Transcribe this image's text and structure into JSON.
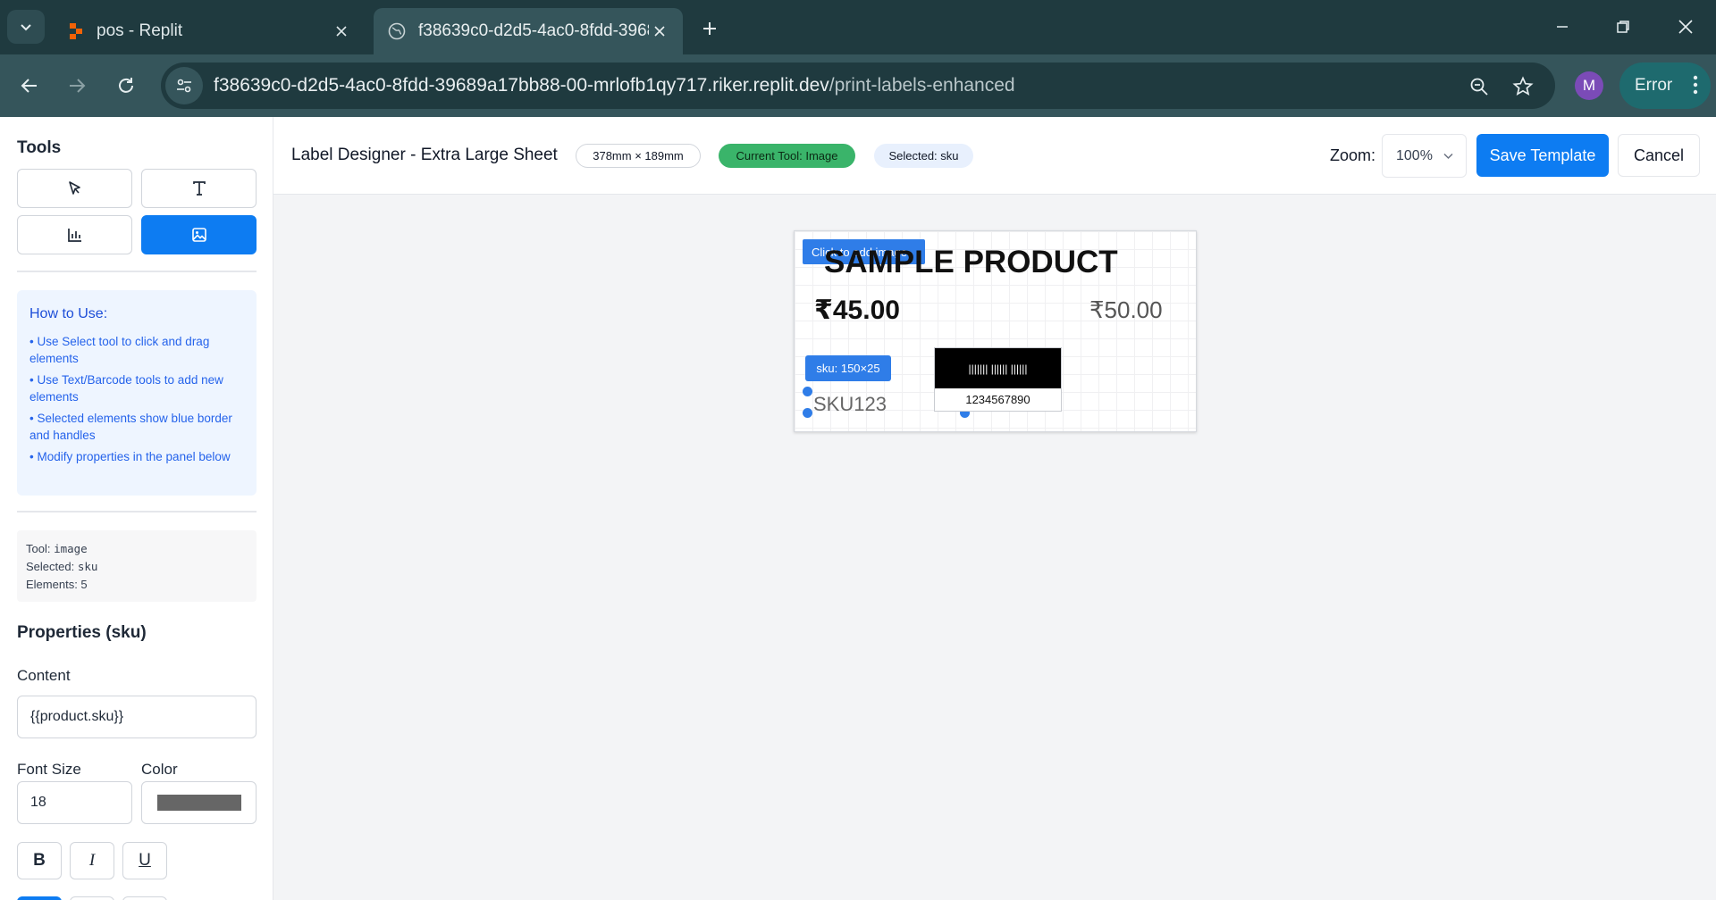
{
  "browser": {
    "tabs": [
      {
        "title": "pos - Replit",
        "active": false,
        "favicon": "replit-logo-icon"
      },
      {
        "title": "f38639c0-d2d5-4ac0-8fdd-3968",
        "active": true,
        "favicon": "globe-icon"
      }
    ],
    "url_host": "f38639c0-d2d5-4ac0-8fdd-39689a17bb88-00-mrlofb1qy717.riker.replit.dev",
    "url_path": "/print-labels-enhanced",
    "profile_initial": "M",
    "error_label": "Error"
  },
  "sidebar": {
    "tools_heading": "Tools",
    "tools": [
      {
        "name": "select",
        "icon": "cursor-arrow-icon",
        "active": false
      },
      {
        "name": "text",
        "icon": "text-t-icon",
        "active": false
      },
      {
        "name": "barcode",
        "icon": "bar-chart-icon",
        "active": false
      },
      {
        "name": "image",
        "icon": "image-icon",
        "active": true
      }
    ],
    "howto": {
      "title": "How to Use:",
      "items": [
        "• Use Select tool to click and drag elements",
        "• Use Text/Barcode tools to add new elements",
        "• Selected elements show blue border and handles",
        "• Modify properties in the panel below"
      ]
    },
    "debug": {
      "tool_label": "Tool: ",
      "tool_value": "image",
      "selected_label": "Selected: ",
      "selected_value": "sku",
      "elements_label": "Elements: ",
      "elements_value": "5"
    },
    "properties_heading": "Properties (sku)",
    "content_label": "Content",
    "content_value": "{{product.sku}}",
    "font_size_label": "Font Size",
    "font_size_value": "18",
    "color_label": "Color",
    "color_value": "#666666",
    "format_buttons": [
      "B",
      "I",
      "U"
    ]
  },
  "topbar": {
    "title": "Label Designer - Extra Large Sheet",
    "size_pill": "378mm × 189mm",
    "tool_pill": "Current Tool: Image",
    "selected_pill": "Selected: sku",
    "zoom_label": "Zoom:",
    "zoom_value": "100%",
    "save_label": "Save Template",
    "cancel_label": "Cancel"
  },
  "label": {
    "image_placeholder": "Click to add image",
    "product_name": "SAMPLE PRODUCT",
    "price": "₹45.00",
    "mrp": "₹50.00",
    "sku_tag": "sku: 150×25",
    "sku_value": "SKU123",
    "barcode_bars": "||||||| |||||| ||||||",
    "barcode_number": "1234567890"
  },
  "colors": {
    "accent": "#0d7cf2",
    "chrome_dark": "#1f3a3f",
    "chrome_mid": "#35555b",
    "success_pill": "#3ab46a",
    "selection_blue": "#2f7de8"
  }
}
